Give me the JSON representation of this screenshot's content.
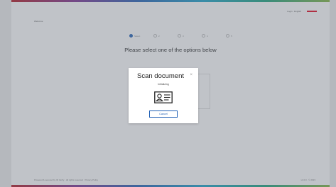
{
  "header": {
    "links_text": "Login · English",
    "brand_label": ""
  },
  "back_link": "Welcome",
  "stepper": {
    "steps": [
      "Select",
      "2",
      "3",
      "4",
      "5"
    ]
  },
  "page": {
    "heading": "Please select one of the options below"
  },
  "footer": {
    "left_text": "Powered & secured by ID Verify · All rights reserved",
    "middle_text": "Privacy Policy",
    "right_text": "v1.0.0 · © 2023"
  },
  "modal": {
    "title": "Scan document",
    "close_label": "×",
    "status": "Initializing",
    "icon": "id-card-icon",
    "cancel_label": "Cancel"
  },
  "colors": {
    "accent": "#1f5fb5",
    "brand": "#e2001a",
    "overlay": "rgba(105,112,125,0.42)"
  }
}
